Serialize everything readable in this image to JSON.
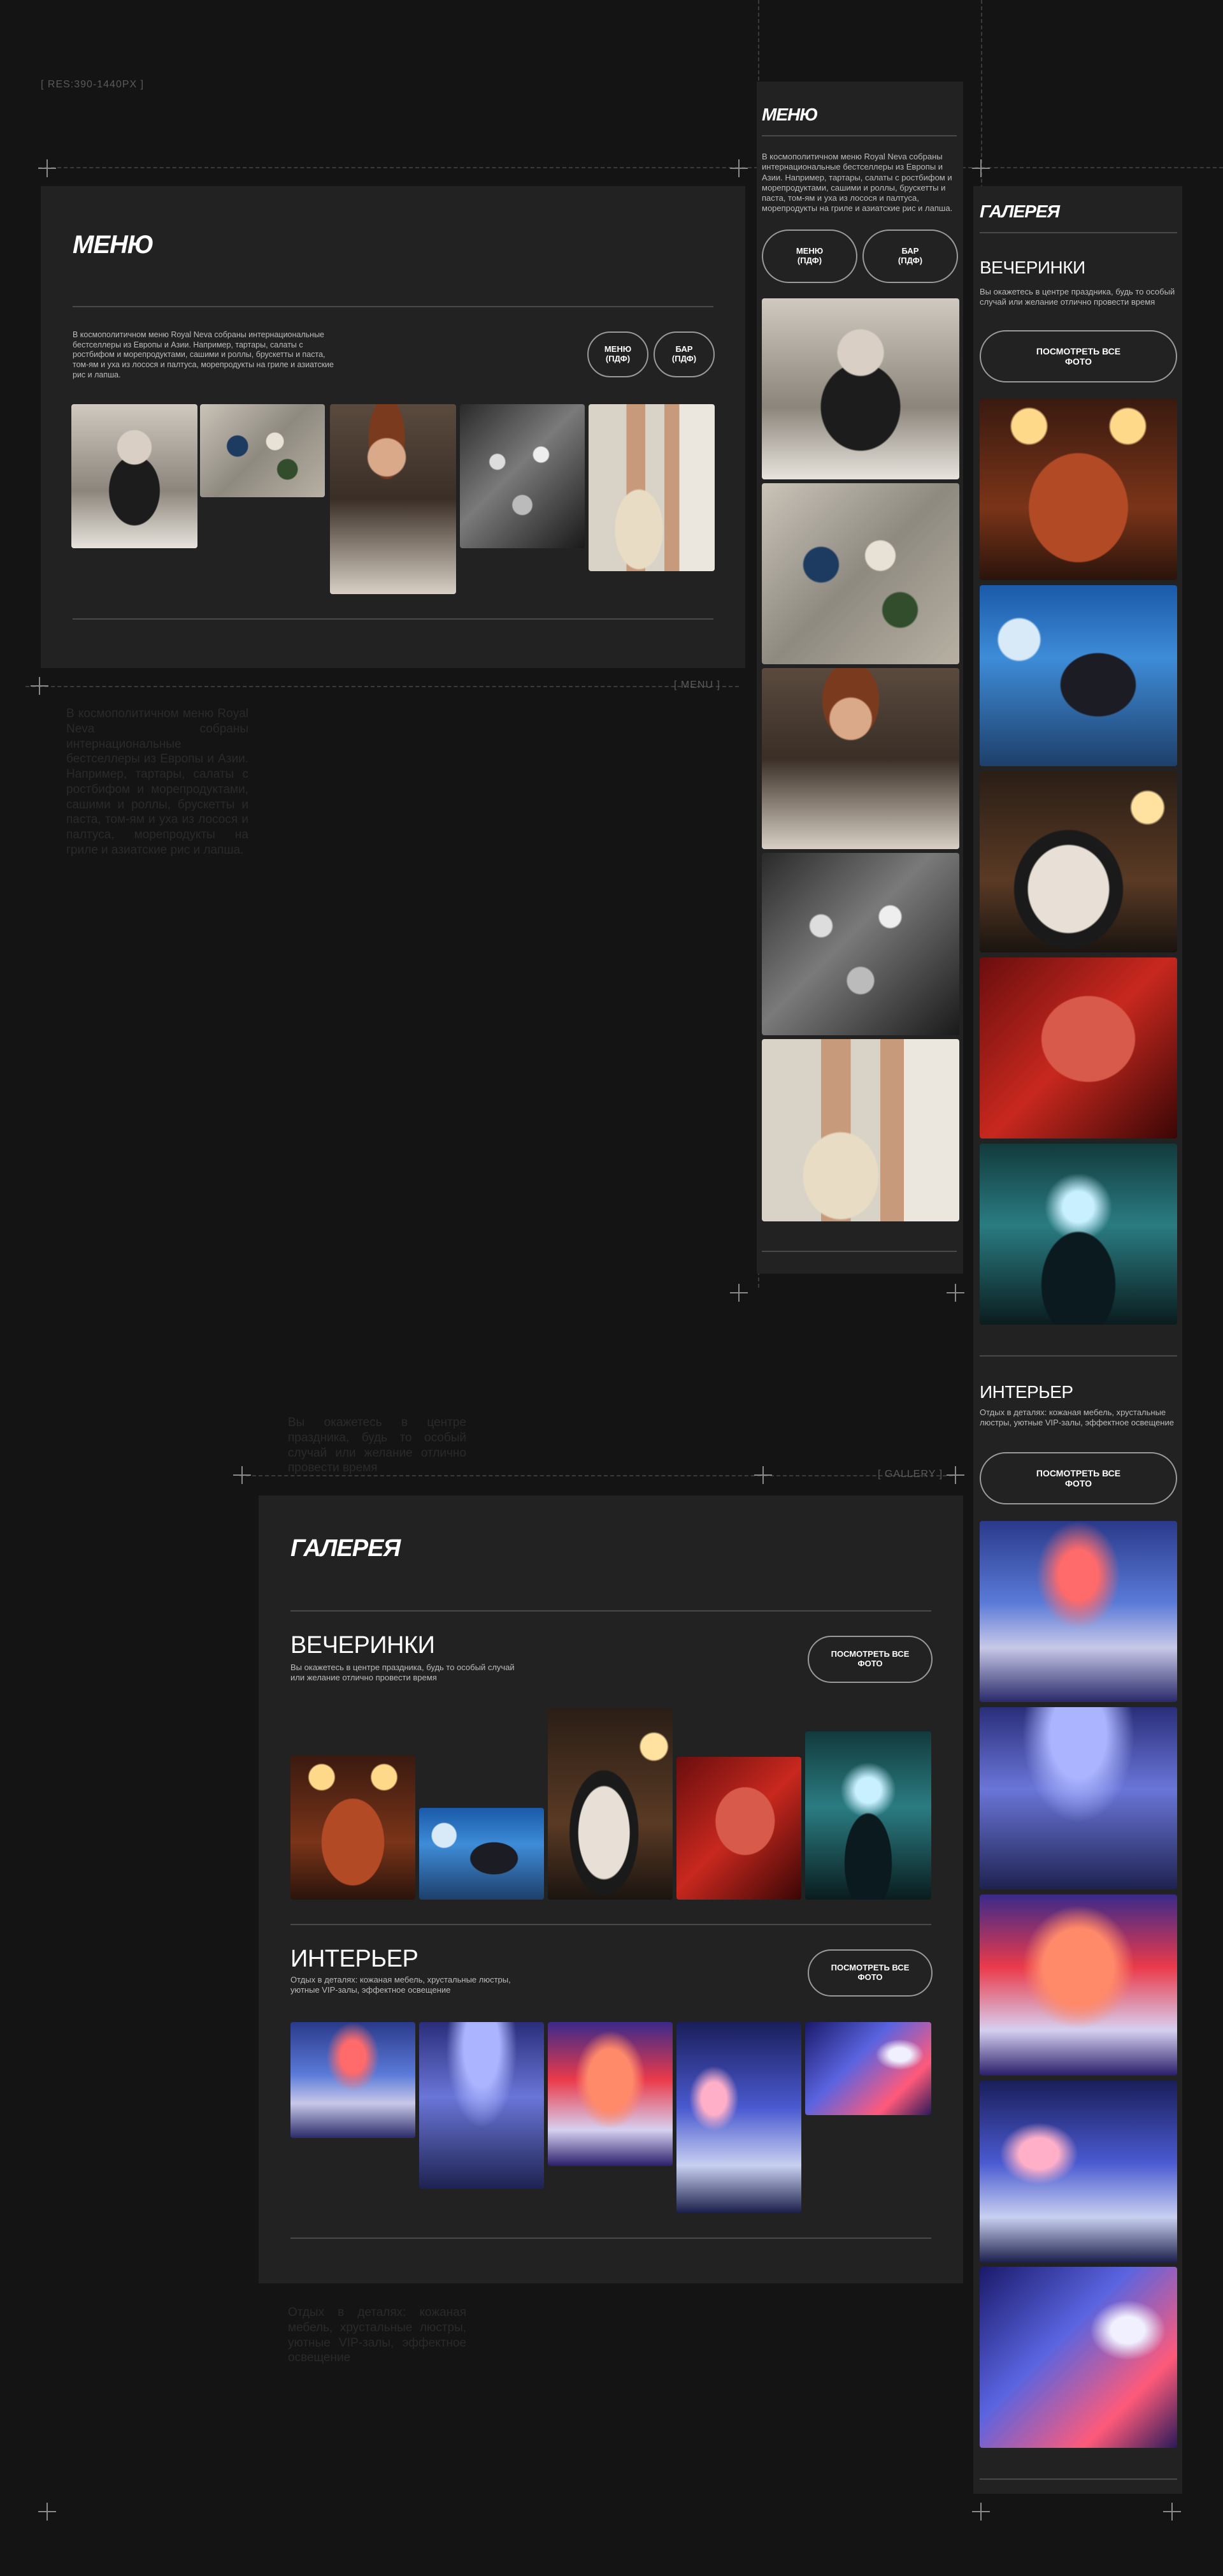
{
  "resolution_tag": "[ RES:390-1440PX ]",
  "menu_tag": "[ MENU ]",
  "gallery_tag": "[ GALLERY ]",
  "menu": {
    "title": "МЕНЮ",
    "description": "В космополитичном меню Royal Neva собраны интернациональные бестселлеры из Европы и Азии. Например, тартары, салаты с ростбифом и морепродуктами, сашими и роллы, брускетты и паста, том-ям и уха из лосося и палтуса, морепродукты на гриле и азиатские рис и лапша.",
    "buttons": {
      "menu_pdf": "МЕНЮ\n(ПДФ)",
      "bar_pdf": "БАР\n(ПДФ)"
    },
    "photos": [
      "food-photo",
      "table-photo",
      "dining-photo",
      "party-photo",
      "legs-table-photo"
    ]
  },
  "gallery": {
    "title": "ГАЛЕРЕЯ",
    "parties": {
      "title": "ВЕЧЕРИНКИ",
      "description": "Вы окажетесь в центре праздника, будь то особый случай или желание отлично провести время",
      "button": "ПОСМОТРЕТЬ ВСЕ\nФОТО"
    },
    "interior": {
      "title": "ИНТЕРЬЕР",
      "description": "Отдых в деталях: кожаная мебель, хрустальные люстры, уютные VIP-залы, эффектное освещение",
      "button": "ПОСМОТРЕТЬ ВСЕ\nФОТО"
    }
  }
}
